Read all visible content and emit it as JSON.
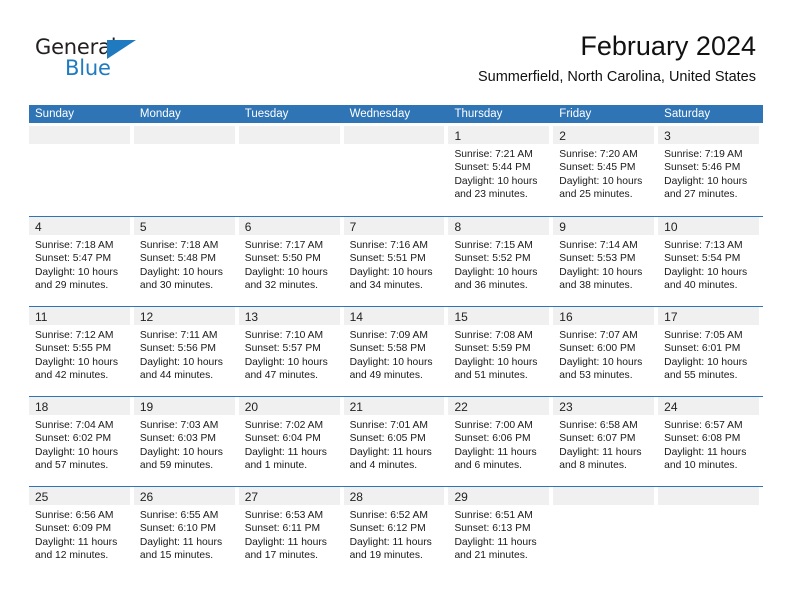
{
  "brand": {
    "name_part1": "General",
    "name_part2": "Blue",
    "triangle_icon": "triangle-icon",
    "color_dark": "#231f20",
    "color_blue": "#1f7ac0"
  },
  "header": {
    "month_title": "February 2024",
    "location": "Summerfield, North Carolina, United States"
  },
  "theme": {
    "header_blue": "#2f74b5",
    "day_bar_gray": "#f0f0f0",
    "text": "#1a1a1a"
  },
  "calendar": {
    "weekday_headers": [
      "Sunday",
      "Monday",
      "Tuesday",
      "Wednesday",
      "Thursday",
      "Friday",
      "Saturday"
    ],
    "weeks": [
      [
        {
          "day": "",
          "sunrise": "",
          "sunset": "",
          "daylight_line1": "",
          "daylight_line2": "",
          "empty": true
        },
        {
          "day": "",
          "sunrise": "",
          "sunset": "",
          "daylight_line1": "",
          "daylight_line2": "",
          "empty": true
        },
        {
          "day": "",
          "sunrise": "",
          "sunset": "",
          "daylight_line1": "",
          "daylight_line2": "",
          "empty": true
        },
        {
          "day": "",
          "sunrise": "",
          "sunset": "",
          "daylight_line1": "",
          "daylight_line2": "",
          "empty": true
        },
        {
          "day": "1",
          "sunrise": "Sunrise: 7:21 AM",
          "sunset": "Sunset: 5:44 PM",
          "daylight_line1": "Daylight: 10 hours",
          "daylight_line2": "and 23 minutes.",
          "empty": false
        },
        {
          "day": "2",
          "sunrise": "Sunrise: 7:20 AM",
          "sunset": "Sunset: 5:45 PM",
          "daylight_line1": "Daylight: 10 hours",
          "daylight_line2": "and 25 minutes.",
          "empty": false
        },
        {
          "day": "3",
          "sunrise": "Sunrise: 7:19 AM",
          "sunset": "Sunset: 5:46 PM",
          "daylight_line1": "Daylight: 10 hours",
          "daylight_line2": "and 27 minutes.",
          "empty": false
        }
      ],
      [
        {
          "day": "4",
          "sunrise": "Sunrise: 7:18 AM",
          "sunset": "Sunset: 5:47 PM",
          "daylight_line1": "Daylight: 10 hours",
          "daylight_line2": "and 29 minutes.",
          "empty": false
        },
        {
          "day": "5",
          "sunrise": "Sunrise: 7:18 AM",
          "sunset": "Sunset: 5:48 PM",
          "daylight_line1": "Daylight: 10 hours",
          "daylight_line2": "and 30 minutes.",
          "empty": false
        },
        {
          "day": "6",
          "sunrise": "Sunrise: 7:17 AM",
          "sunset": "Sunset: 5:50 PM",
          "daylight_line1": "Daylight: 10 hours",
          "daylight_line2": "and 32 minutes.",
          "empty": false
        },
        {
          "day": "7",
          "sunrise": "Sunrise: 7:16 AM",
          "sunset": "Sunset: 5:51 PM",
          "daylight_line1": "Daylight: 10 hours",
          "daylight_line2": "and 34 minutes.",
          "empty": false
        },
        {
          "day": "8",
          "sunrise": "Sunrise: 7:15 AM",
          "sunset": "Sunset: 5:52 PM",
          "daylight_line1": "Daylight: 10 hours",
          "daylight_line2": "and 36 minutes.",
          "empty": false
        },
        {
          "day": "9",
          "sunrise": "Sunrise: 7:14 AM",
          "sunset": "Sunset: 5:53 PM",
          "daylight_line1": "Daylight: 10 hours",
          "daylight_line2": "and 38 minutes.",
          "empty": false
        },
        {
          "day": "10",
          "sunrise": "Sunrise: 7:13 AM",
          "sunset": "Sunset: 5:54 PM",
          "daylight_line1": "Daylight: 10 hours",
          "daylight_line2": "and 40 minutes.",
          "empty": false
        }
      ],
      [
        {
          "day": "11",
          "sunrise": "Sunrise: 7:12 AM",
          "sunset": "Sunset: 5:55 PM",
          "daylight_line1": "Daylight: 10 hours",
          "daylight_line2": "and 42 minutes.",
          "empty": false
        },
        {
          "day": "12",
          "sunrise": "Sunrise: 7:11 AM",
          "sunset": "Sunset: 5:56 PM",
          "daylight_line1": "Daylight: 10 hours",
          "daylight_line2": "and 44 minutes.",
          "empty": false
        },
        {
          "day": "13",
          "sunrise": "Sunrise: 7:10 AM",
          "sunset": "Sunset: 5:57 PM",
          "daylight_line1": "Daylight: 10 hours",
          "daylight_line2": "and 47 minutes.",
          "empty": false
        },
        {
          "day": "14",
          "sunrise": "Sunrise: 7:09 AM",
          "sunset": "Sunset: 5:58 PM",
          "daylight_line1": "Daylight: 10 hours",
          "daylight_line2": "and 49 minutes.",
          "empty": false
        },
        {
          "day": "15",
          "sunrise": "Sunrise: 7:08 AM",
          "sunset": "Sunset: 5:59 PM",
          "daylight_line1": "Daylight: 10 hours",
          "daylight_line2": "and 51 minutes.",
          "empty": false
        },
        {
          "day": "16",
          "sunrise": "Sunrise: 7:07 AM",
          "sunset": "Sunset: 6:00 PM",
          "daylight_line1": "Daylight: 10 hours",
          "daylight_line2": "and 53 minutes.",
          "empty": false
        },
        {
          "day": "17",
          "sunrise": "Sunrise: 7:05 AM",
          "sunset": "Sunset: 6:01 PM",
          "daylight_line1": "Daylight: 10 hours",
          "daylight_line2": "and 55 minutes.",
          "empty": false
        }
      ],
      [
        {
          "day": "18",
          "sunrise": "Sunrise: 7:04 AM",
          "sunset": "Sunset: 6:02 PM",
          "daylight_line1": "Daylight: 10 hours",
          "daylight_line2": "and 57 minutes.",
          "empty": false
        },
        {
          "day": "19",
          "sunrise": "Sunrise: 7:03 AM",
          "sunset": "Sunset: 6:03 PM",
          "daylight_line1": "Daylight: 10 hours",
          "daylight_line2": "and 59 minutes.",
          "empty": false
        },
        {
          "day": "20",
          "sunrise": "Sunrise: 7:02 AM",
          "sunset": "Sunset: 6:04 PM",
          "daylight_line1": "Daylight: 11 hours",
          "daylight_line2": "and 1 minute.",
          "empty": false
        },
        {
          "day": "21",
          "sunrise": "Sunrise: 7:01 AM",
          "sunset": "Sunset: 6:05 PM",
          "daylight_line1": "Daylight: 11 hours",
          "daylight_line2": "and 4 minutes.",
          "empty": false
        },
        {
          "day": "22",
          "sunrise": "Sunrise: 7:00 AM",
          "sunset": "Sunset: 6:06 PM",
          "daylight_line1": "Daylight: 11 hours",
          "daylight_line2": "and 6 minutes.",
          "empty": false
        },
        {
          "day": "23",
          "sunrise": "Sunrise: 6:58 AM",
          "sunset": "Sunset: 6:07 PM",
          "daylight_line1": "Daylight: 11 hours",
          "daylight_line2": "and 8 minutes.",
          "empty": false
        },
        {
          "day": "24",
          "sunrise": "Sunrise: 6:57 AM",
          "sunset": "Sunset: 6:08 PM",
          "daylight_line1": "Daylight: 11 hours",
          "daylight_line2": "and 10 minutes.",
          "empty": false
        }
      ],
      [
        {
          "day": "25",
          "sunrise": "Sunrise: 6:56 AM",
          "sunset": "Sunset: 6:09 PM",
          "daylight_line1": "Daylight: 11 hours",
          "daylight_line2": "and 12 minutes.",
          "empty": false
        },
        {
          "day": "26",
          "sunrise": "Sunrise: 6:55 AM",
          "sunset": "Sunset: 6:10 PM",
          "daylight_line1": "Daylight: 11 hours",
          "daylight_line2": "and 15 minutes.",
          "empty": false
        },
        {
          "day": "27",
          "sunrise": "Sunrise: 6:53 AM",
          "sunset": "Sunset: 6:11 PM",
          "daylight_line1": "Daylight: 11 hours",
          "daylight_line2": "and 17 minutes.",
          "empty": false
        },
        {
          "day": "28",
          "sunrise": "Sunrise: 6:52 AM",
          "sunset": "Sunset: 6:12 PM",
          "daylight_line1": "Daylight: 11 hours",
          "daylight_line2": "and 19 minutes.",
          "empty": false
        },
        {
          "day": "29",
          "sunrise": "Sunrise: 6:51 AM",
          "sunset": "Sunset: 6:13 PM",
          "daylight_line1": "Daylight: 11 hours",
          "daylight_line2": "and 21 minutes.",
          "empty": false
        },
        {
          "day": "",
          "sunrise": "",
          "sunset": "",
          "daylight_line1": "",
          "daylight_line2": "",
          "empty": true
        },
        {
          "day": "",
          "sunrise": "",
          "sunset": "",
          "daylight_line1": "",
          "daylight_line2": "",
          "empty": true
        }
      ]
    ]
  }
}
